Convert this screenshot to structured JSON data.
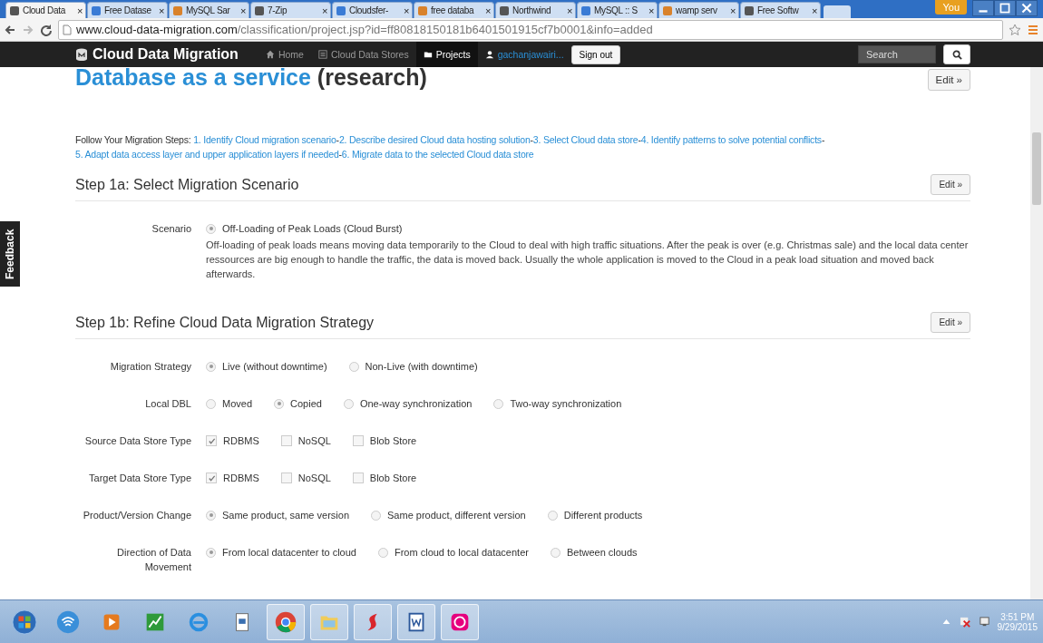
{
  "browser": {
    "tabs": [
      {
        "title": "Cloud Data",
        "selected": true
      },
      {
        "title": "Free Datase",
        "selected": false
      },
      {
        "title": "MySQL Sar",
        "selected": false
      },
      {
        "title": "7-Zip",
        "selected": false
      },
      {
        "title": "Cloudsfer-",
        "selected": false
      },
      {
        "title": "free databa",
        "selected": false
      },
      {
        "title": "Northwind",
        "selected": false
      },
      {
        "title": "MySQL :: S",
        "selected": false
      },
      {
        "title": "wamp serv",
        "selected": false
      },
      {
        "title": "Free Softw",
        "selected": false
      }
    ],
    "close_glyph": "×",
    "profile": "You",
    "url_host": "www.cloud-data-migration.com",
    "url_path": "/classification/project.jsp?id=ff80818150181b6401501915cf7b0001&info=added"
  },
  "navbar": {
    "brand": "Cloud Data Migration",
    "items": [
      {
        "label": "Home",
        "selected": false
      },
      {
        "label": "Cloud Data Stores",
        "selected": false
      },
      {
        "label": "Projects",
        "selected": true
      }
    ],
    "user": "gachanjawairi...",
    "sign_out": "Sign out",
    "search": {
      "placeholder": "Search"
    }
  },
  "feedback": "Feedback",
  "project": {
    "title": "Database as a service",
    "suffix": "(research)",
    "edit": "Edit »"
  },
  "steps": {
    "intro": "Follow Your Migration Steps:",
    "separator": "-",
    "links": [
      "1. Identify Cloud migration scenario",
      "2. Describe desired Cloud data hosting solution",
      "3. Select Cloud data store",
      "4. Identify patterns to solve potential conflicts",
      "5. Adapt data access layer and upper application layers if needed",
      "6. Migrate data to the selected Cloud data store"
    ]
  },
  "sections": [
    {
      "heading": "Step 1a: Select Migration Scenario",
      "edit": "Edit »",
      "rows": [
        {
          "label": "Scenario",
          "kind": "radio",
          "options": [
            {
              "label": "Off-Loading of Peak Loads (Cloud Burst)",
              "selected": true
            }
          ],
          "description": "Off-loading of peak loads means moving data temporarily to the Cloud to deal with high traffic situations. After the peak is over (e.g. Christmas sale) and the local data center ressources are big enough to handle the traffic, the data is moved back. Usually the whole application is moved to the Cloud in a peak load situation and moved back afterwards."
        }
      ]
    },
    {
      "heading": "Step 1b: Refine Cloud Data Migration Strategy",
      "edit": "Edit »",
      "rows": [
        {
          "label": "Migration Strategy",
          "kind": "radio",
          "options": [
            {
              "label": "Live (without downtime)",
              "selected": true
            },
            {
              "label": "Non-Live (with downtime)",
              "selected": false
            }
          ]
        },
        {
          "label": "Local DBL",
          "kind": "radio",
          "options": [
            {
              "label": "Moved",
              "selected": false
            },
            {
              "label": "Copied",
              "selected": true
            },
            {
              "label": "One-way synchronization",
              "selected": false
            },
            {
              "label": "Two-way synchronization",
              "selected": false
            }
          ]
        },
        {
          "label": "Source Data Store Type",
          "kind": "checkbox",
          "options": [
            {
              "label": "RDBMS",
              "checked": true
            },
            {
              "label": "NoSQL",
              "checked": false
            },
            {
              "label": "Blob Store",
              "checked": false
            }
          ]
        },
        {
          "label": "Target Data Store Type",
          "kind": "checkbox",
          "options": [
            {
              "label": "RDBMS",
              "checked": true
            },
            {
              "label": "NoSQL",
              "checked": false
            },
            {
              "label": "Blob Store",
              "checked": false
            }
          ]
        },
        {
          "label": "Product/Version Change",
          "kind": "radio",
          "options": [
            {
              "label": "Same product, same version",
              "selected": true
            },
            {
              "label": "Same product, different version",
              "selected": false
            },
            {
              "label": "Different products",
              "selected": false
            }
          ]
        },
        {
          "label": "Direction of Data Movement",
          "kind": "radio",
          "options": [
            {
              "label": "From local datacenter to cloud",
              "selected": true
            },
            {
              "label": "From cloud to local datacenter",
              "selected": false
            },
            {
              "label": "Between clouds",
              "selected": false
            }
          ]
        }
      ]
    }
  ],
  "taskbar": {
    "apps": [
      {
        "kind": "start",
        "running": false
      },
      {
        "kind": "wifi",
        "running": false
      },
      {
        "kind": "media",
        "running": false
      },
      {
        "kind": "chart",
        "running": false
      },
      {
        "kind": "ie",
        "running": false
      },
      {
        "kind": "doc",
        "running": false
      },
      {
        "kind": "chrome",
        "running": true
      },
      {
        "kind": "folder",
        "running": true
      },
      {
        "kind": "swirl",
        "running": true
      },
      {
        "kind": "word",
        "running": true
      },
      {
        "kind": "wamp",
        "running": true
      }
    ],
    "time": "3:51 PM",
    "date": "9/29/2015"
  }
}
